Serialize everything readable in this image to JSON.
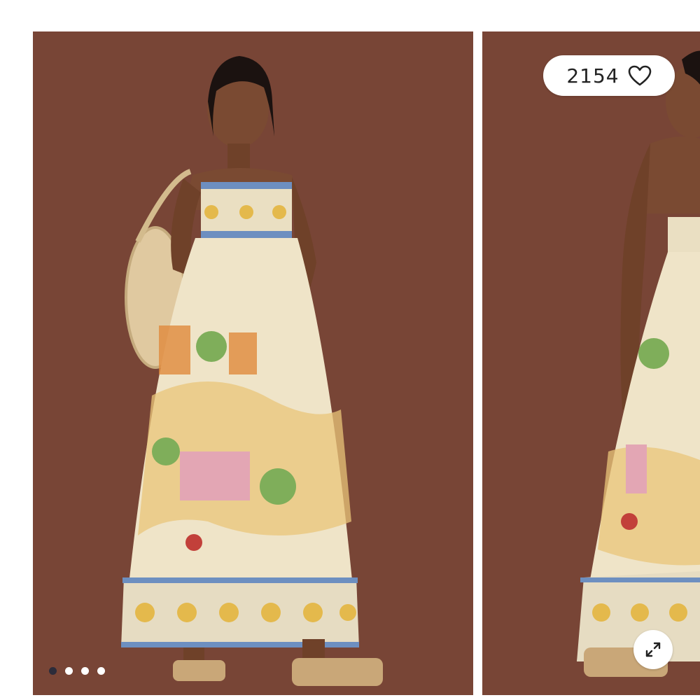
{
  "gallery": {
    "like_count": "2154",
    "icons": {
      "like": "heart-outline-icon",
      "expand": "expand-arrows-icon"
    },
    "dots": {
      "total": 4,
      "active_index": 0
    },
    "colors": {
      "backdrop": "#784536",
      "page": "#ffffff",
      "active_dot": "#2c2c3a"
    }
  }
}
